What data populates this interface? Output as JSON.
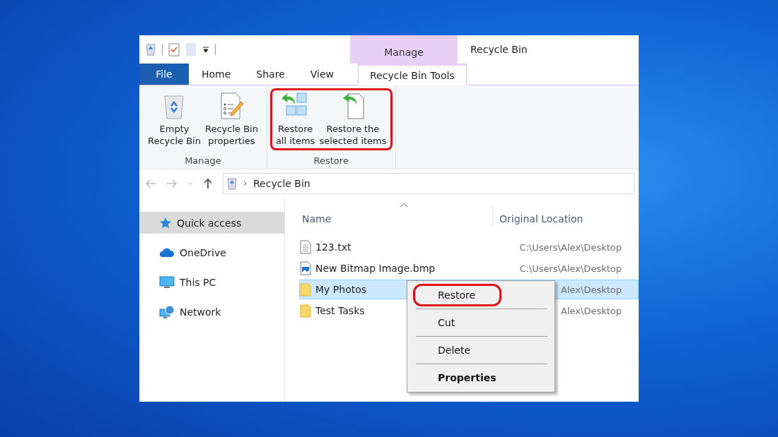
{
  "window": {
    "title": "Recycle Bin"
  },
  "contextual_tab": {
    "label": "Manage"
  },
  "tabs": [
    {
      "label": "File",
      "kind": "file",
      "selected": false
    },
    {
      "label": "Home",
      "kind": "plain",
      "selected": false
    },
    {
      "label": "Share",
      "kind": "plain",
      "selected": false
    },
    {
      "label": "View",
      "kind": "plain",
      "selected": false
    },
    {
      "label": "Recycle Bin Tools",
      "kind": "contextual",
      "selected": true
    }
  ],
  "ribbon_groups": [
    {
      "label": "Manage",
      "highlighted": false,
      "buttons": [
        {
          "label": "Empty\nRecycle Bin",
          "kind": "bin"
        },
        {
          "label": "Recycle Bin\nproperties",
          "kind": "properties"
        }
      ]
    },
    {
      "label": "Restore",
      "highlighted": true,
      "buttons": [
        {
          "label": "Restore\nall items",
          "kind": "restore_all"
        },
        {
          "label": "Restore the\nselected items",
          "kind": "restore_selected"
        }
      ]
    }
  ],
  "address_bar": {
    "path": "Recycle Bin"
  },
  "sidebar": {
    "items": [
      {
        "label": "Quick access",
        "kind": "star",
        "selected": true
      },
      {
        "label": "OneDrive",
        "kind": "cloud",
        "selected": false
      },
      {
        "label": "This PC",
        "kind": "pc",
        "selected": false
      },
      {
        "label": "Network",
        "kind": "network",
        "selected": false
      }
    ]
  },
  "table": {
    "columns": [
      "Name",
      "Original Location"
    ],
    "rows": [
      {
        "name": "123.txt",
        "kind": "text",
        "location": "C:\\Users\\Alex\\Desktop",
        "selected": false
      },
      {
        "name": "New Bitmap Image.bmp",
        "kind": "image",
        "location": "C:\\Users\\Alex\\Desktop",
        "selected": false
      },
      {
        "name": "My Photos",
        "kind": "folder",
        "location": "Alex\\Desktop",
        "selected": true
      },
      {
        "name": "Test Tasks",
        "kind": "folder",
        "location": "Alex\\Desktop",
        "selected": false
      }
    ]
  },
  "context_menu": {
    "items": [
      {
        "kind": "item",
        "label": "Restore",
        "bold": false,
        "highlighted": true
      },
      {
        "kind": "separator"
      },
      {
        "kind": "item",
        "label": "Cut",
        "bold": false,
        "highlighted": false
      },
      {
        "kind": "separator"
      },
      {
        "kind": "item",
        "label": "Delete",
        "bold": false,
        "highlighted": false
      },
      {
        "kind": "separator"
      },
      {
        "kind": "item",
        "label": "Properties",
        "bold": true,
        "highlighted": false
      }
    ]
  }
}
